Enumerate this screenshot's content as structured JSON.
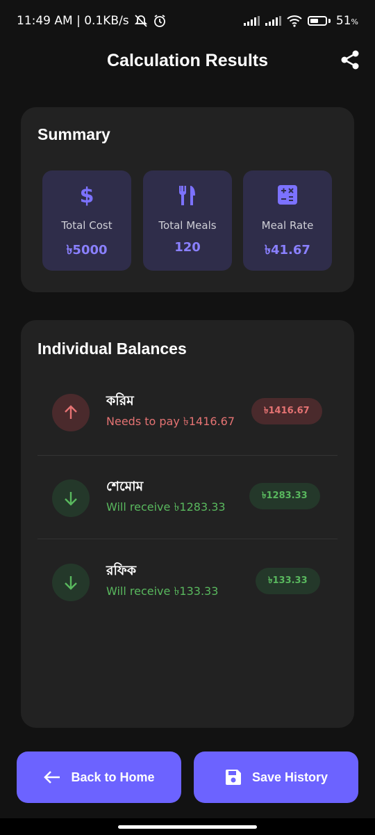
{
  "status_bar": {
    "time_speed": "11:49 AM | 0.1KB/s",
    "battery": "51",
    "battery_unit": "%"
  },
  "header": {
    "title": "Calculation Results",
    "share_icon": "share-icon"
  },
  "summary": {
    "title": "Summary",
    "stats": [
      {
        "icon": "dollar-icon",
        "label": "Total Cost",
        "value": "৳5000"
      },
      {
        "icon": "utensils-icon",
        "label": "Total Meals",
        "value": "120"
      },
      {
        "icon": "calculator-icon",
        "label": "Meal Rate",
        "value": "৳41.67"
      }
    ]
  },
  "balances": {
    "title": "Individual Balances",
    "people": [
      {
        "name": "করিম",
        "status": "Needs to pay ৳1416.67",
        "badge": "৳1416.67",
        "type": "pay"
      },
      {
        "name": "শেমোম",
        "status": "Will receive ৳1283.33",
        "badge": "৳1283.33",
        "type": "receive"
      },
      {
        "name": "রফিক",
        "status": "Will receive ৳133.33",
        "badge": "৳133.33",
        "type": "receive"
      }
    ]
  },
  "actions": {
    "back_label": "Back to Home",
    "save_label": "Save History"
  },
  "colors": {
    "accent": "#6C63FF",
    "pay": "#E57373",
    "receive": "#59B85E",
    "card": "#222222",
    "background": "#121212"
  }
}
